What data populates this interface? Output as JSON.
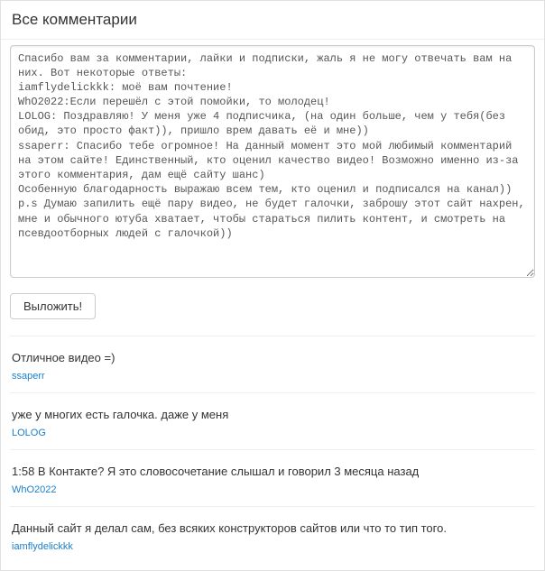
{
  "title": "Все комментарии",
  "textarea_value": "Спасибо вам за комментарии, лайки и подписки, жаль я не могу отвечать вам на них. Вот некоторые ответы:\niamflydelickkk: моё вам почтение!\nWhO2022:Если перешёл с этой помойки, то молодец!\nLOLOG: Поздравляю! У меня уже 4 подписчика, (на один больше, чем у тебя(без обид, это просто факт)), пришло врем давать её и мне))\nssaperr: Спасибо тебе огромное! На данный момент это мой любимый комментарий на этом сайте! Единственный, кто оценил качество видео! Возможно именно из-за этого комментария, дам ещё сайту шанс)\nОсобенную благодарность выражаю всем тем, кто оценил и подписался на канал))\np.s Думаю запилить ещё пару видео, не будет галочки, заброшу этот сайт нахрен, мне и обычного ютуба хватает, чтобы стараться пилить контент, и смотреть на псевдоотборных людей с галочкой))",
  "submit_label": "Выложить!",
  "comments": [
    {
      "text": "Отличное видео =)",
      "author": "ssaperr"
    },
    {
      "text": "уже у многих есть галочка. даже у меня",
      "author": "LOLOG"
    },
    {
      "text": "1:58 В Контакте? Я это словосочетание слышал и говорил 3 месяца назад",
      "author": "WhO2022"
    },
    {
      "text": "Данный сайт я делал сам, без всяких конструкторов сайтов или что то тип того.",
      "author": "iamflydelickkk"
    }
  ]
}
